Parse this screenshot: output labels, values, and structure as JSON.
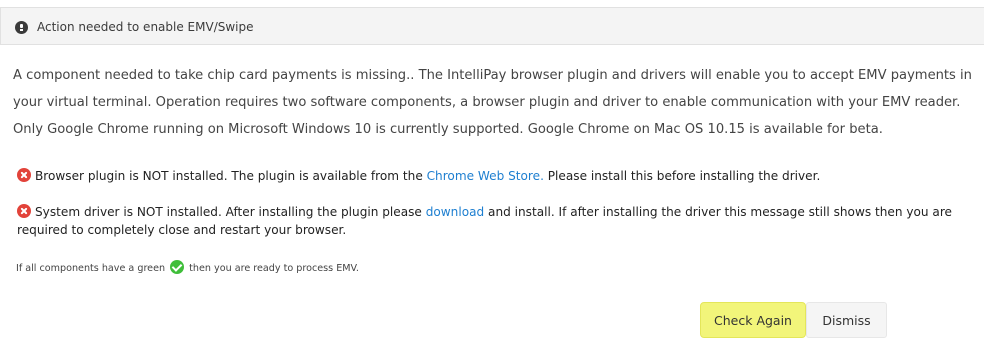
{
  "header": {
    "icon": "exclamation-circle-icon",
    "title": "Action needed to enable EMV/Swipe"
  },
  "intro_text": "A component needed to take chip card payments is missing.. The IntelliPay browser plugin and drivers will enable you to accept EMV payments in your virtual terminal. Operation requires two software components, a browser plugin and driver to enable communication with your EMV reader. Only Google Chrome running on Microsoft Windows 10 is currently supported. Google Chrome on Mac OS 10.15 is available for beta.",
  "plugin_status": {
    "icon": "error-x-icon",
    "text_before": "Browser plugin is NOT installed. The plugin is available from the ",
    "link": "Chrome Web Store.",
    "text_after": " Please install this before installing the driver."
  },
  "driver_status": {
    "icon": "error-x-icon",
    "text_before": "System driver is NOT installed. After installing the plugin please ",
    "link": "download",
    "text_after": " and install. If after installing the driver this message still shows then you are required to completely close and restart your browser."
  },
  "footnote": {
    "text_before": "If all components have a green ",
    "icon": "green-check-icon",
    "text_after": " then you are ready to process EMV."
  },
  "buttons": {
    "check_again": "Check Again",
    "dismiss": "Dismiss"
  },
  "colors": {
    "error": "#e2433a",
    "success": "#3fbe3a",
    "link": "#1e7fd0",
    "highlight": "#f2f57a",
    "header_bg": "#f4f4f4"
  }
}
